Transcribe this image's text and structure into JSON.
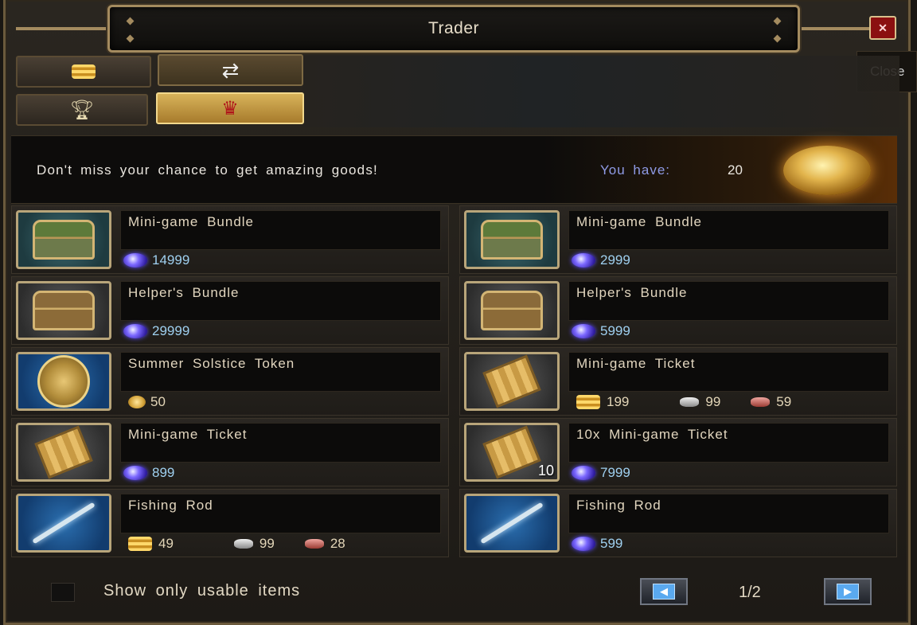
{
  "window": {
    "title": "Trader"
  },
  "close": {
    "label": "✕",
    "tooltip": "Close"
  },
  "tabs_top": [
    {
      "icon": "gold-coins-icon"
    },
    {
      "icon": "exchange-arrows-icon"
    }
  ],
  "tabs_sub": [
    {
      "icon": "trophy-icon"
    },
    {
      "icon": "crown-icon"
    }
  ],
  "banner": {
    "message": "Don't miss your chance to get amazing goods!",
    "you_have_label": "You have:",
    "you_have_value": "20"
  },
  "items": [
    {
      "name": "Mini-game Bundle",
      "price": "14999",
      "currency": "gem",
      "thumb": "green-chest"
    },
    {
      "name": "Mini-game Bundle",
      "price": "2999",
      "currency": "gem",
      "thumb": "green-chest"
    },
    {
      "name": "Helper's Bundle",
      "price": "29999",
      "currency": "gem",
      "thumb": "wooden-chest"
    },
    {
      "name": "Helper's Bundle",
      "price": "5999",
      "currency": "gem",
      "thumb": "wooden-chest"
    },
    {
      "name": "Summer Solstice Token",
      "price": "50",
      "currency": "token",
      "thumb": "token"
    },
    {
      "name": "Mini-game Ticket",
      "gold": "199",
      "silver": "99",
      "copper": "59",
      "currency": "mixed",
      "thumb": "ticket"
    },
    {
      "name": "Mini-game Ticket",
      "price": "899",
      "currency": "gem",
      "thumb": "ticket"
    },
    {
      "name": "10x Mini-game Ticket",
      "price": "7999",
      "currency": "gem",
      "thumb": "ticket",
      "stack": "10"
    },
    {
      "name": "Fishing Rod",
      "gold": "49",
      "silver": "99",
      "copper": "28",
      "currency": "mixed",
      "thumb": "rod"
    },
    {
      "name": "Fishing Rod",
      "price": "599",
      "currency": "gem",
      "thumb": "rod"
    }
  ],
  "footer": {
    "checkbox_label": "Show only usable items",
    "page": "1/2",
    "prev": "◀",
    "next": "▶"
  }
}
